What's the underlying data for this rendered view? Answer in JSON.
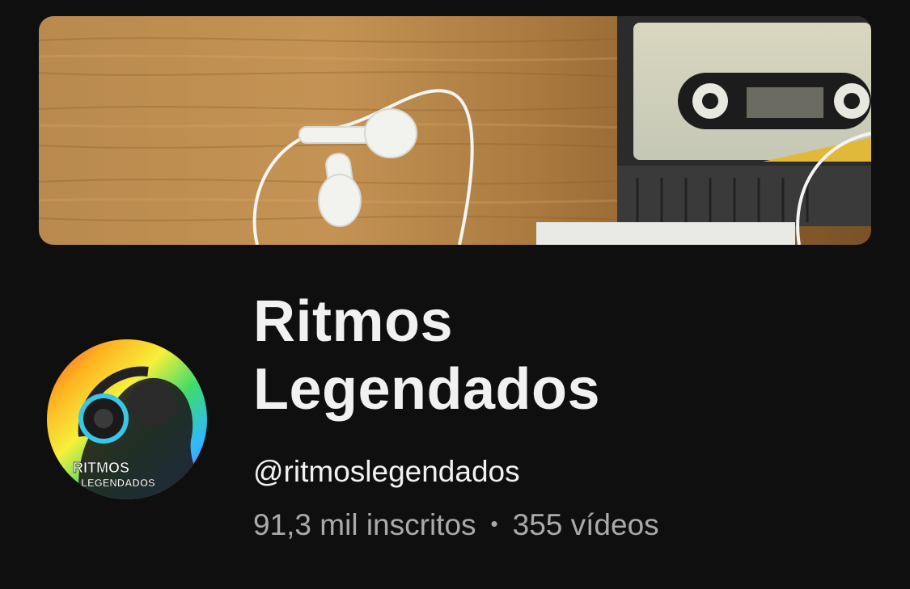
{
  "banner": {
    "alt": ""
  },
  "avatar": {
    "line1": "RITMOS",
    "line2": "LEGENDADOS"
  },
  "channel": {
    "name_line1": "Ritmos",
    "name_line2": "Legendados",
    "handle": "@ritmoslegendados",
    "subscribers": "91,3 mil inscritos",
    "separator": "•",
    "videos": "355 vídeos"
  },
  "colors": {
    "background": "#0f0f0f",
    "text_primary": "#f1f1f1",
    "text_secondary": "#aaaaaa"
  }
}
